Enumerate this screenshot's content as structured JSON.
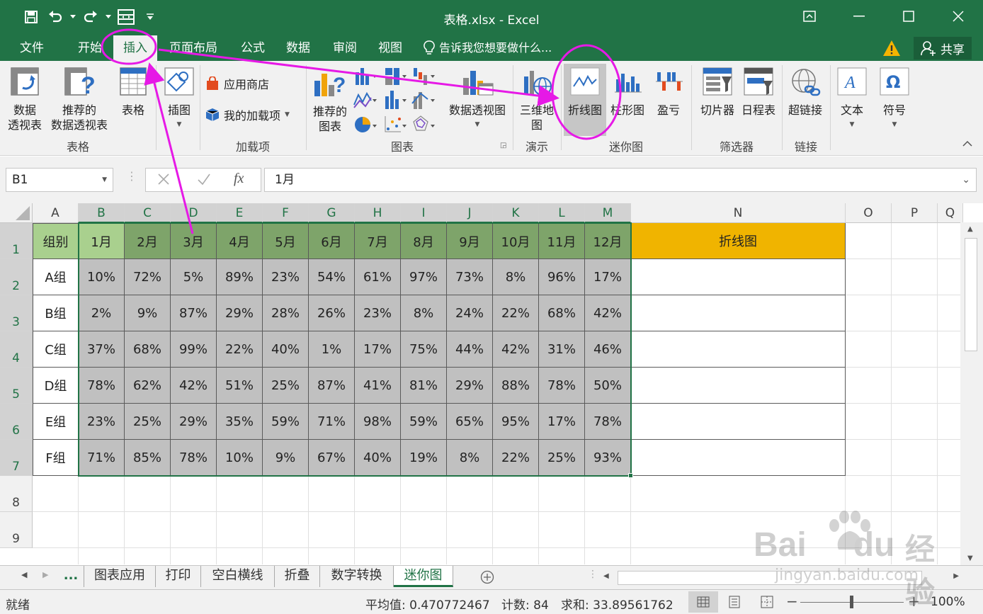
{
  "window": {
    "title": "表格.xlsx - Excel"
  },
  "tabs": [
    {
      "label": "文件"
    },
    {
      "label": "开始"
    },
    {
      "label": "插入"
    },
    {
      "label": "页面布局"
    },
    {
      "label": "公式"
    },
    {
      "label": "数据"
    },
    {
      "label": "审阅"
    },
    {
      "label": "视图"
    }
  ],
  "tell_me": "告诉我您想要做什么...",
  "share": "共享",
  "ribbon": {
    "pivot_line1": "数据",
    "pivot_line2": "透视表",
    "rec_pivot_line1": "推荐的",
    "rec_pivot_line2": "数据透视表",
    "table": "表格",
    "illustrations": "插图",
    "app_store": "应用商店",
    "my_addins": "我的加载项",
    "rec_charts_line1": "推荐的",
    "rec_charts_line2": "图表",
    "pivot_chart": "数据透视图",
    "map3d_line1": "三维地",
    "map3d_line2": "图",
    "spark_line": "折线图",
    "spark_column": "柱形图",
    "spark_winloss": "盈亏",
    "slicer": "切片器",
    "timeline": "日程表",
    "hyperlink": "超链接",
    "text": "文本",
    "symbol": "符号",
    "groups": {
      "tables": "表格",
      "addins": "加载项",
      "charts": "图表",
      "tours": "演示",
      "sparklines": "迷你图",
      "filters": "筛选器",
      "links": "链接"
    }
  },
  "formula_bar": {
    "name_box": "B1",
    "fx": "fx",
    "content": "1月"
  },
  "sheet": {
    "columns": [
      "A",
      "B",
      "C",
      "D",
      "E",
      "F",
      "G",
      "H",
      "I",
      "J",
      "K",
      "L",
      "M",
      "N",
      "O",
      "P",
      "Q"
    ],
    "rows": [
      "1",
      "2",
      "3",
      "4",
      "5",
      "6",
      "7",
      "8",
      "9"
    ],
    "header_row": [
      "组别",
      "1月",
      "2月",
      "3月",
      "4月",
      "5月",
      "6月",
      "7月",
      "8月",
      "9月",
      "10月",
      "11月",
      "12月",
      "折线图"
    ],
    "data": [
      [
        "A组",
        "10%",
        "72%",
        "5%",
        "89%",
        "23%",
        "54%",
        "61%",
        "97%",
        "73%",
        "8%",
        "96%",
        "17%"
      ],
      [
        "B组",
        "2%",
        "9%",
        "87%",
        "29%",
        "28%",
        "26%",
        "23%",
        "8%",
        "24%",
        "22%",
        "68%",
        "42%"
      ],
      [
        "C组",
        "37%",
        "68%",
        "99%",
        "22%",
        "40%",
        "1%",
        "17%",
        "75%",
        "44%",
        "42%",
        "31%",
        "46%"
      ],
      [
        "D组",
        "78%",
        "62%",
        "42%",
        "51%",
        "25%",
        "87%",
        "41%",
        "81%",
        "29%",
        "88%",
        "78%",
        "50%"
      ],
      [
        "E组",
        "23%",
        "25%",
        "29%",
        "35%",
        "59%",
        "71%",
        "98%",
        "59%",
        "65%",
        "95%",
        "17%",
        "78%"
      ],
      [
        "F组",
        "71%",
        "85%",
        "78%",
        "10%",
        "9%",
        "67%",
        "40%",
        "19%",
        "8%",
        "22%",
        "25%",
        "93%"
      ]
    ]
  },
  "sheet_tabs": [
    {
      "label": "..."
    },
    {
      "label": "图表应用"
    },
    {
      "label": "打印"
    },
    {
      "label": "空白横线"
    },
    {
      "label": "折叠"
    },
    {
      "label": "数字转换"
    },
    {
      "label": "迷你图"
    }
  ],
  "status": {
    "ready": "就绪",
    "average": "平均值: 0.470772467",
    "count": "计数: 84",
    "sum": "求和: 33.89561762",
    "zoom": "100%"
  },
  "watermark": {
    "line1": "Bai",
    "line2": "du",
    "cn": "经验",
    "url": "jingyan.baidu.com"
  },
  "colors": {
    "excel_green": "#217346",
    "annotation": "#e619e6",
    "header_fill": "#f0b400",
    "selected_fill": "#c0c0c0"
  }
}
